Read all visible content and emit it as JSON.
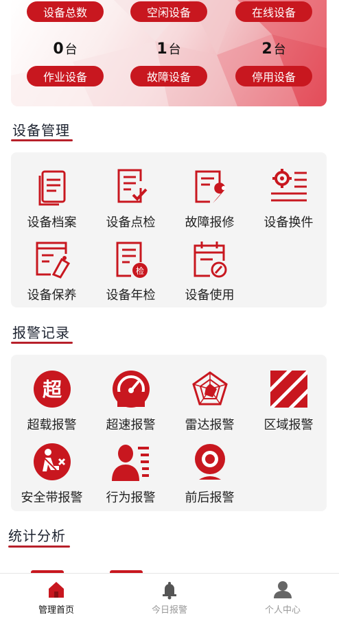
{
  "banner": {
    "stats_top": [
      {
        "label": "设备总数"
      },
      {
        "label": "空闲设备"
      },
      {
        "label": "在线设备"
      }
    ],
    "stats_bottom": [
      {
        "label": "作业设备",
        "value": "0",
        "unit": "台"
      },
      {
        "label": "故障设备",
        "value": "1",
        "unit": "台"
      },
      {
        "label": "停用设备",
        "value": "2",
        "unit": "台"
      }
    ]
  },
  "device_management": {
    "title": "设备管理",
    "items": [
      {
        "label": "设备档案",
        "icon": "archive-doc-icon"
      },
      {
        "label": "设备点检",
        "icon": "checklist-icon"
      },
      {
        "label": "故障报修",
        "icon": "repair-wrench-icon"
      },
      {
        "label": "设备换件",
        "icon": "gear-list-icon"
      },
      {
        "label": "设备保养",
        "icon": "maintenance-icon"
      },
      {
        "label": "设备年检",
        "icon": "annual-inspection-icon"
      },
      {
        "label": "设备使用",
        "icon": "calendar-usage-icon"
      }
    ]
  },
  "alarm_records": {
    "title": "报警记录",
    "items": [
      {
        "label": "超载报警",
        "icon": "overload-icon",
        "glyph": "超"
      },
      {
        "label": "超速报警",
        "icon": "speedometer-icon"
      },
      {
        "label": "雷达报警",
        "icon": "radar-icon"
      },
      {
        "label": "区域报警",
        "icon": "zone-stripes-icon"
      },
      {
        "label": "安全带报警",
        "icon": "seatbelt-icon"
      },
      {
        "label": "行为报警",
        "icon": "behavior-person-icon"
      },
      {
        "label": "前后报警",
        "icon": "camera-icon"
      }
    ]
  },
  "statistics": {
    "title": "统计分析"
  },
  "bottom_nav": {
    "tabs": [
      {
        "label": "管理首页",
        "icon": "home-icon",
        "active": true
      },
      {
        "label": "今日报警",
        "icon": "bell-icon",
        "active": false
      },
      {
        "label": "个人中心",
        "icon": "user-icon",
        "active": false
      }
    ]
  },
  "colors": {
    "accent": "#c8171f",
    "section_underline": "#b7202a",
    "card_bg": "#f4f4f4"
  }
}
